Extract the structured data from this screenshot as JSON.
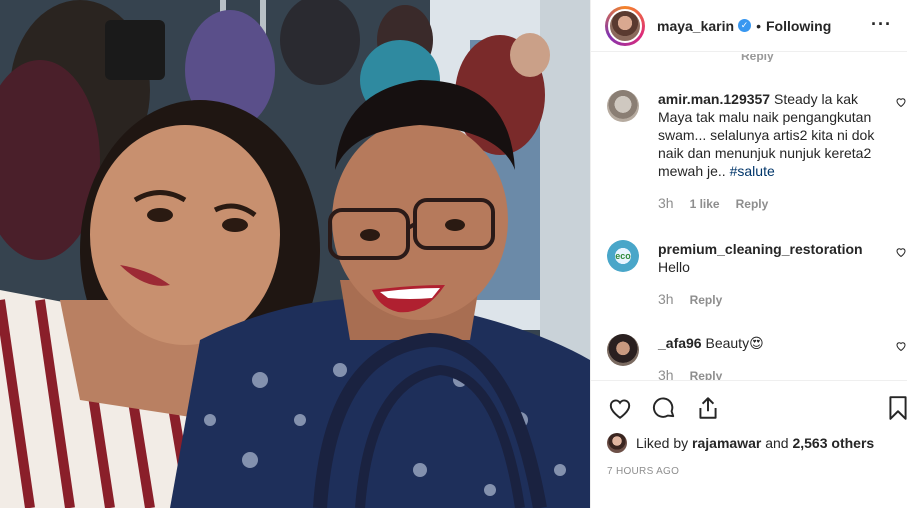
{
  "header": {
    "username": "maya_karin",
    "verified_glyph": "✓",
    "separator": "•",
    "follow_status": "Following",
    "more_glyph": "···"
  },
  "comments": [
    {
      "username": "amir.man.129357",
      "text": "Steady la kak Maya tak malu naik pengangkutan swam... selalunya artis2 kita ni dok naik dan menunjuk nunjuk kereta2 mewah je..",
      "hashtag": "#salute",
      "time": "3h",
      "likes": "1 like",
      "reply": "Reply"
    },
    {
      "username": "premium_cleaning_restoration",
      "text": "Hello",
      "avatar_text": "eco",
      "time": "3h",
      "reply": "Reply"
    },
    {
      "username": "_afa96",
      "text": "Beauty",
      "emoji": "😍",
      "time": "3h",
      "reply": "Reply"
    }
  ],
  "cut_reply_text": "Reply",
  "likes": {
    "prefix": "Liked by",
    "user": "rajamawar",
    "and": "and",
    "others": "2,563 others"
  },
  "timestamp": "7 HOURS AGO",
  "icons": [
    "heart-icon",
    "comment-icon",
    "share-icon",
    "bookmark-icon"
  ],
  "colors": {
    "link": "#003569",
    "verified": "#3897f0",
    "meta": "#8e8e8e"
  }
}
